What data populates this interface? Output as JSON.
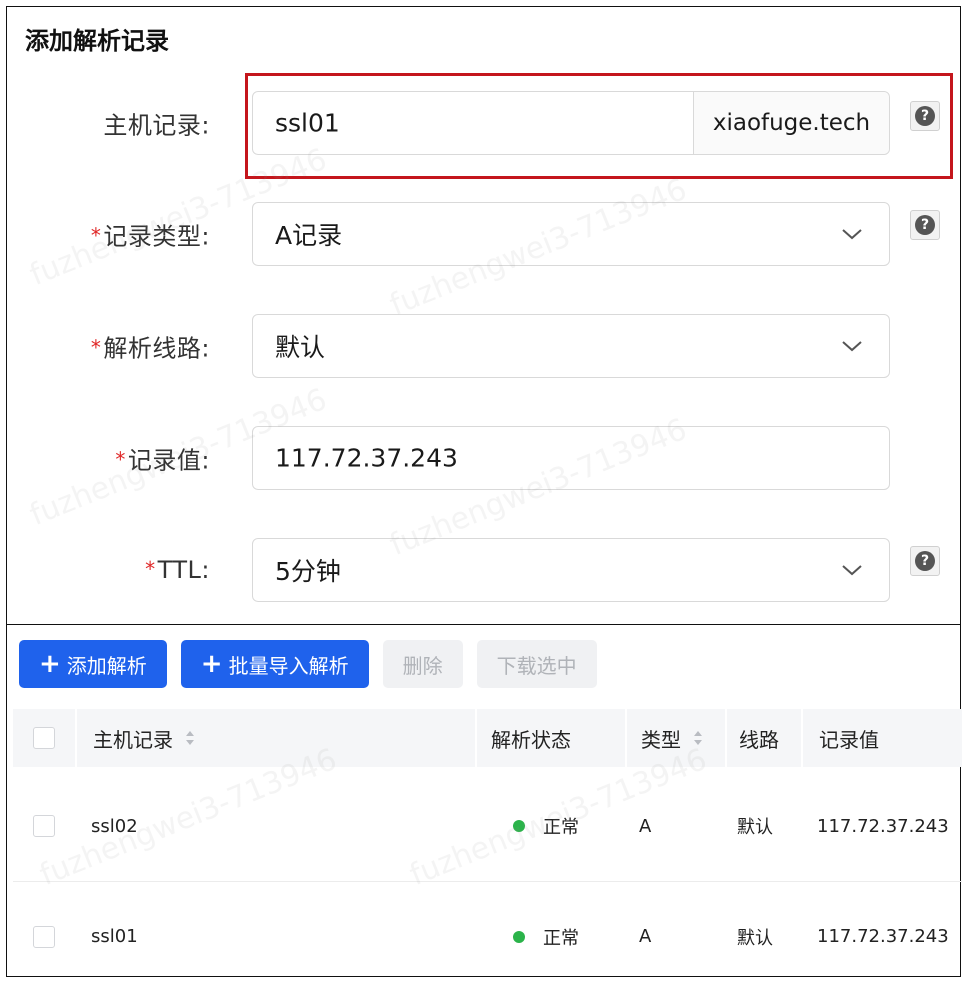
{
  "form": {
    "title": "添加解析记录",
    "host_record": {
      "label": "主机记录:",
      "value": "ssl01",
      "suffix": "xiaofuge.tech"
    },
    "record_type": {
      "required_mark": "*",
      "label": "记录类型:",
      "value": "A记录"
    },
    "line": {
      "required_mark": "*",
      "label": "解析线路:",
      "value": "默认"
    },
    "record_value": {
      "required_mark": "*",
      "label": "记录值:",
      "value": "117.72.37.243"
    },
    "ttl": {
      "required_mark": "*",
      "label": "TTL:",
      "value": "5分钟"
    },
    "help_glyph": "?"
  },
  "toolbar": {
    "plus_glyph": "+",
    "add_label": "添加解析",
    "import_label": "批量导入解析",
    "delete_label": "删除",
    "download_label": "下载选中"
  },
  "table": {
    "columns": {
      "host": "主机记录",
      "status": "解析状态",
      "type": "类型",
      "line": "线路",
      "value": "记录值"
    },
    "rows": [
      {
        "host": "ssl02",
        "status": "正常",
        "type": "A",
        "line": "默认",
        "value": "117.72.37.243"
      },
      {
        "host": "ssl01",
        "status": "正常",
        "type": "A",
        "line": "默认",
        "value": "117.72.37.243"
      }
    ]
  },
  "watermark": "fuzhengwei3-713946",
  "colors": {
    "primary": "#1f62ec",
    "highlight_border": "#c4161c",
    "required": "#e02828",
    "status_ok": "#2bb34a"
  }
}
